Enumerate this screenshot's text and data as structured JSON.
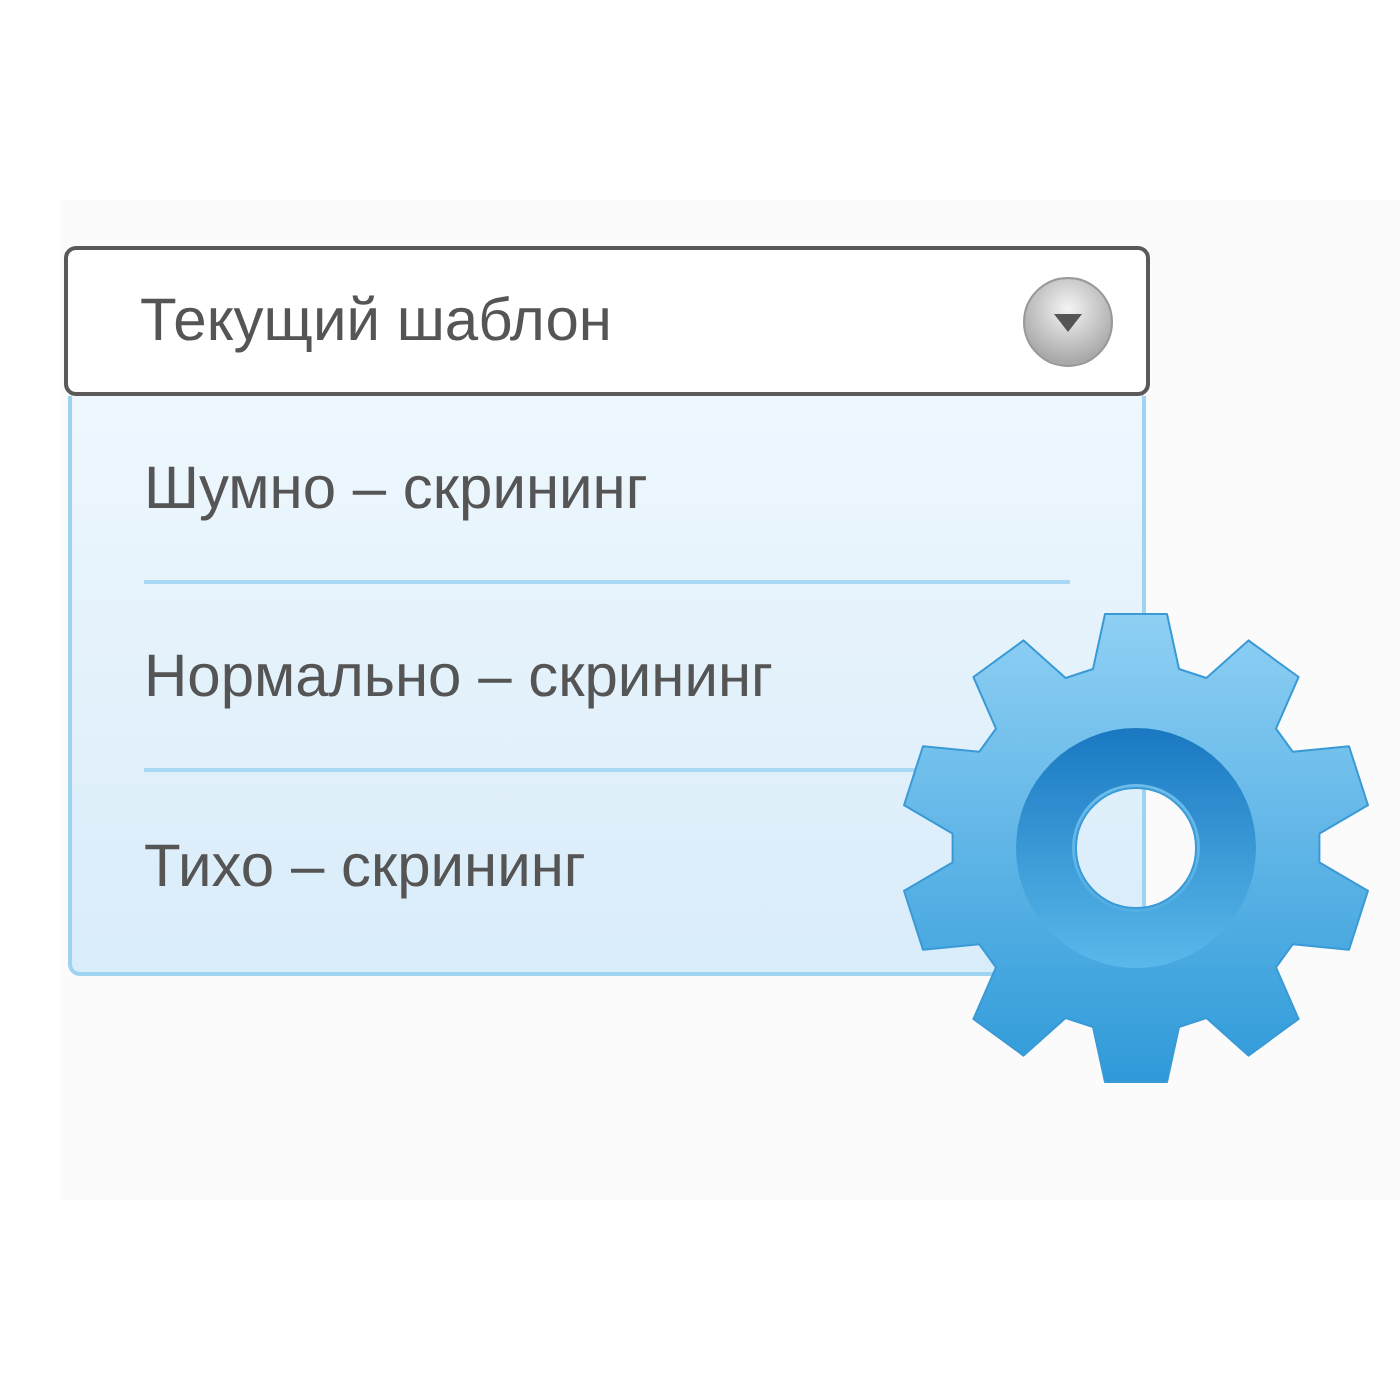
{
  "dropdown": {
    "value": "Текущий шаблон",
    "expanded": true
  },
  "options": [
    {
      "label": "Шумно – скрининг"
    },
    {
      "label": "Нормально – скрининг"
    },
    {
      "label": "Тихо – скрининг"
    }
  ]
}
